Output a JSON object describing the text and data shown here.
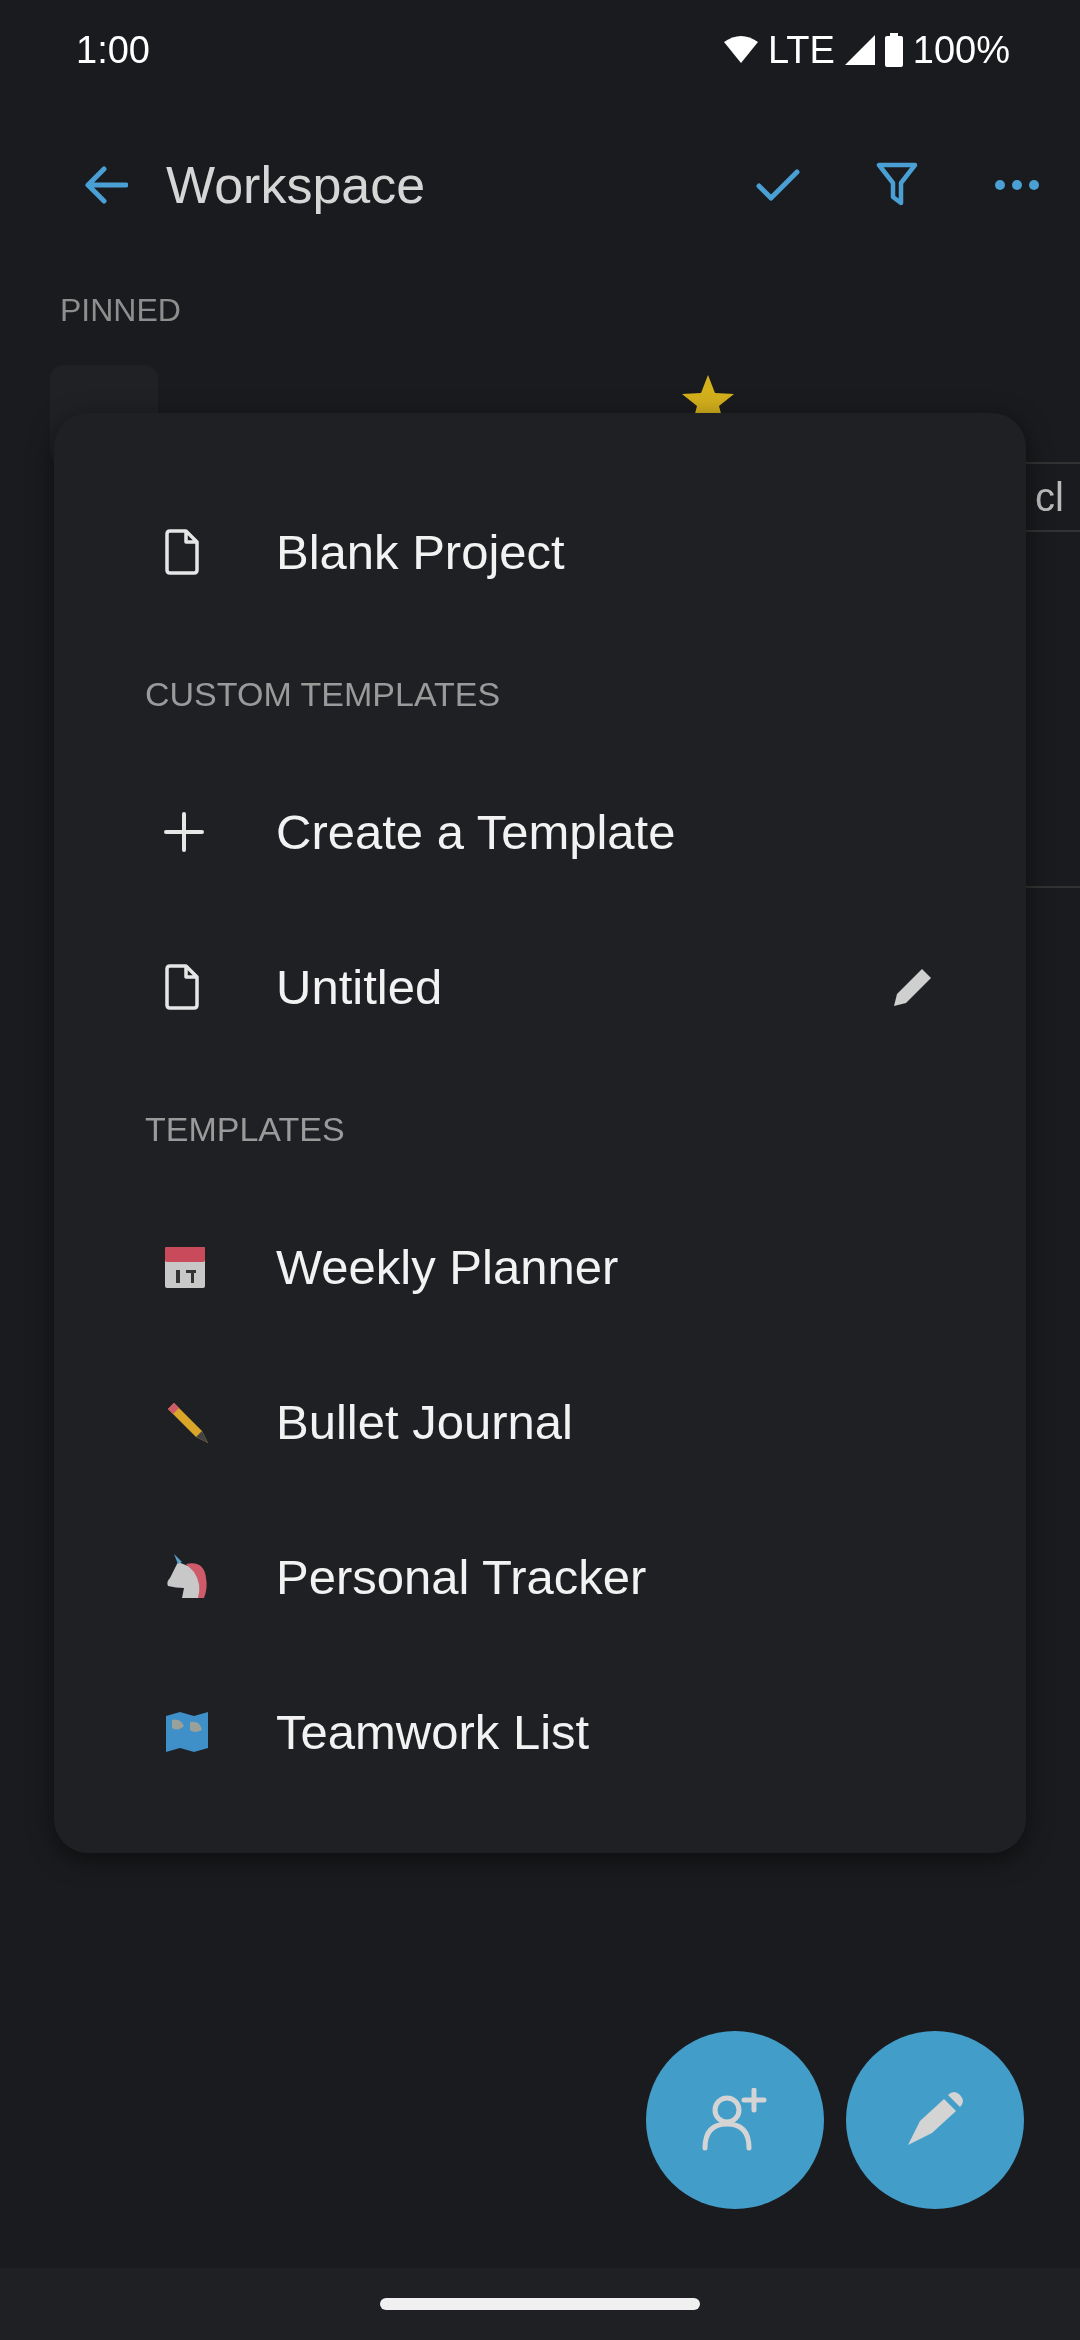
{
  "status_bar": {
    "time": "1:00",
    "network": "LTE",
    "battery": "100%"
  },
  "toolbar": {
    "title": "Workspace"
  },
  "pinned": {
    "heading": "PINNED",
    "items": [
      {
        "starred": true
      }
    ],
    "side_text": "cl"
  },
  "menu": {
    "sections": [
      {
        "items": [
          {
            "label": "Blank Project",
            "kind": "file"
          }
        ]
      },
      {
        "heading": "CUSTOM TEMPLATES",
        "items": [
          {
            "label": "Create a Template",
            "kind": "add"
          },
          {
            "label": "Untitled",
            "kind": "file",
            "editable": true
          }
        ]
      },
      {
        "heading": "TEMPLATES",
        "items": [
          {
            "label": "Weekly Planner",
            "kind": "calendar"
          },
          {
            "label": "Bullet Journal",
            "kind": "pencil"
          },
          {
            "label": "Personal Tracker",
            "kind": "unicorn"
          },
          {
            "label": "Teamwork List",
            "kind": "map"
          }
        ]
      }
    ]
  }
}
